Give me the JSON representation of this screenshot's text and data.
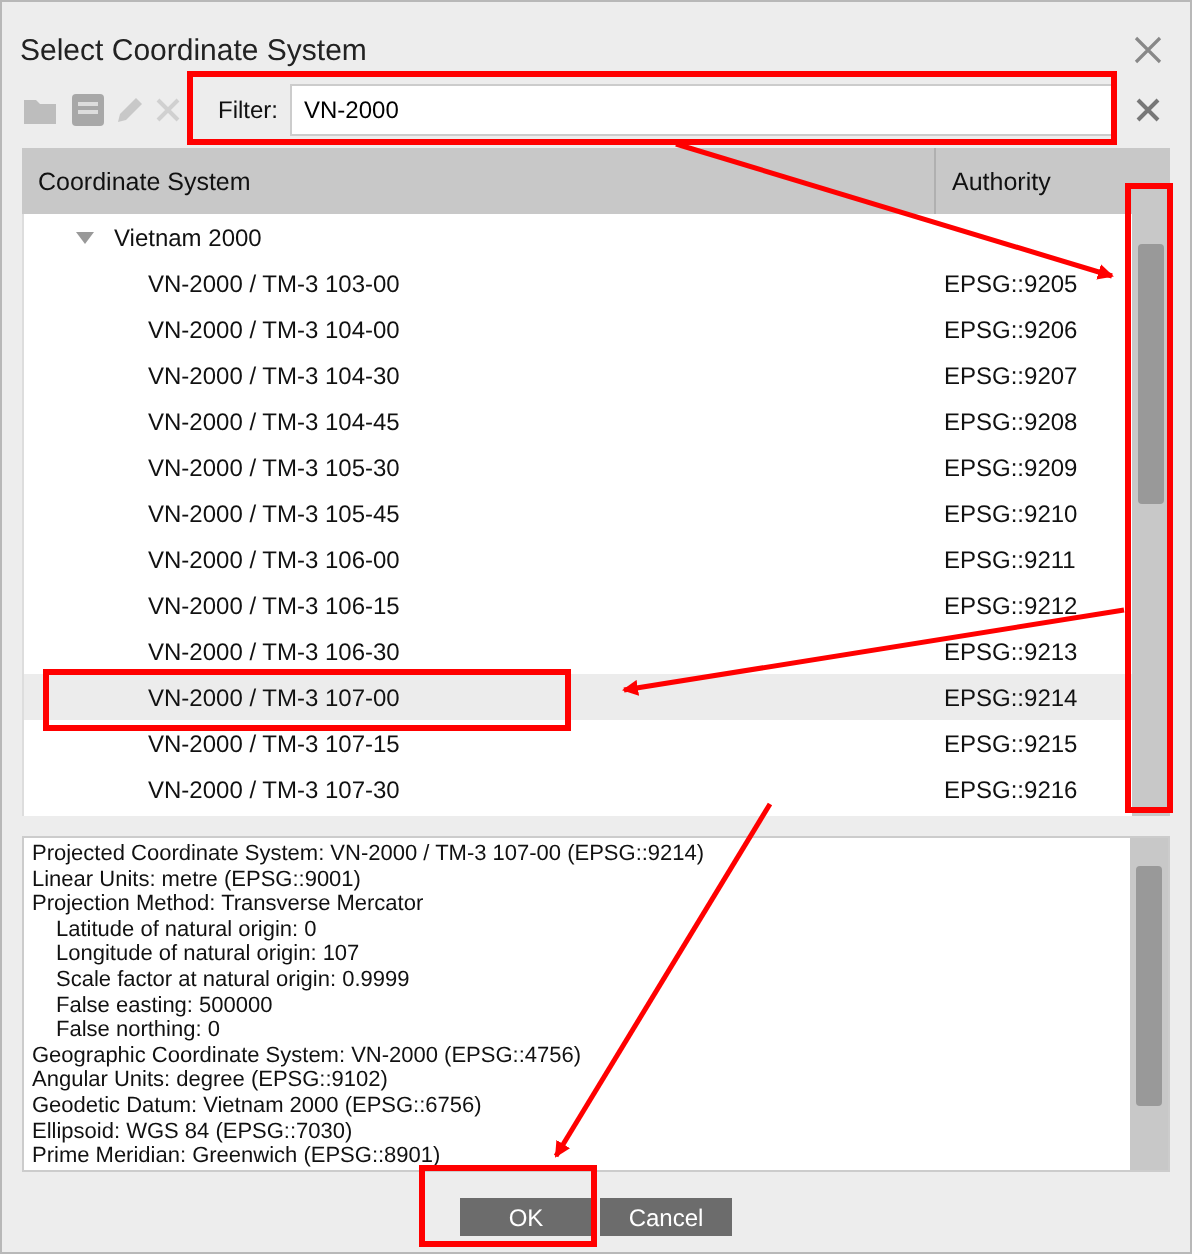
{
  "window": {
    "title": "Select Coordinate System"
  },
  "filter": {
    "label": "Filter:",
    "value": "VN-2000"
  },
  "table": {
    "columns": [
      "Coordinate System",
      "Authority"
    ],
    "groups": [
      {
        "label": "Vietnam 2000",
        "expanded": true,
        "rows": [
          {
            "name": "VN-2000 / TM-3 103-00",
            "authority": "EPSG::9205",
            "selected": false
          },
          {
            "name": "VN-2000 / TM-3 104-00",
            "authority": "EPSG::9206",
            "selected": false
          },
          {
            "name": "VN-2000 / TM-3 104-30",
            "authority": "EPSG::9207",
            "selected": false
          },
          {
            "name": "VN-2000 / TM-3 104-45",
            "authority": "EPSG::9208",
            "selected": false
          },
          {
            "name": "VN-2000 / TM-3 105-30",
            "authority": "EPSG::9209",
            "selected": false
          },
          {
            "name": "VN-2000 / TM-3 105-45",
            "authority": "EPSG::9210",
            "selected": false
          },
          {
            "name": "VN-2000 / TM-3 106-00",
            "authority": "EPSG::9211",
            "selected": false
          },
          {
            "name": "VN-2000 / TM-3 106-15",
            "authority": "EPSG::9212",
            "selected": false
          },
          {
            "name": "VN-2000 / TM-3 106-30",
            "authority": "EPSG::9213",
            "selected": false
          },
          {
            "name": "VN-2000 / TM-3 107-00",
            "authority": "EPSG::9214",
            "selected": true
          },
          {
            "name": "VN-2000 / TM-3 107-15",
            "authority": "EPSG::9215",
            "selected": false
          },
          {
            "name": "VN-2000 / TM-3 107-30",
            "authority": "EPSG::9216",
            "selected": false
          }
        ]
      }
    ]
  },
  "details": [
    {
      "text": "Projected Coordinate System: VN-2000 / TM-3 107-00 (EPSG::9214)"
    },
    {
      "text": "Linear Units: metre (EPSG::9001)"
    },
    {
      "text": "Projection Method: Transverse Mercator",
      "children": [
        {
          "text": "Latitude of natural origin: 0"
        },
        {
          "text": "Longitude of natural origin: 107"
        },
        {
          "text": "Scale factor at natural origin: 0.9999"
        },
        {
          "text": "False easting: 500000"
        },
        {
          "text": "False northing: 0"
        }
      ]
    },
    {
      "text": "Geographic Coordinate System: VN-2000 (EPSG::4756)"
    },
    {
      "text": "Angular Units: degree (EPSG::9102)"
    },
    {
      "text": "Geodetic Datum: Vietnam 2000 (EPSG::6756)"
    },
    {
      "text": "Ellipsoid: WGS 84 (EPSG::7030)"
    },
    {
      "text": "Prime Meridian: Greenwich (EPSG::8901)"
    }
  ],
  "buttons": [
    "OK",
    "Cancel"
  ]
}
